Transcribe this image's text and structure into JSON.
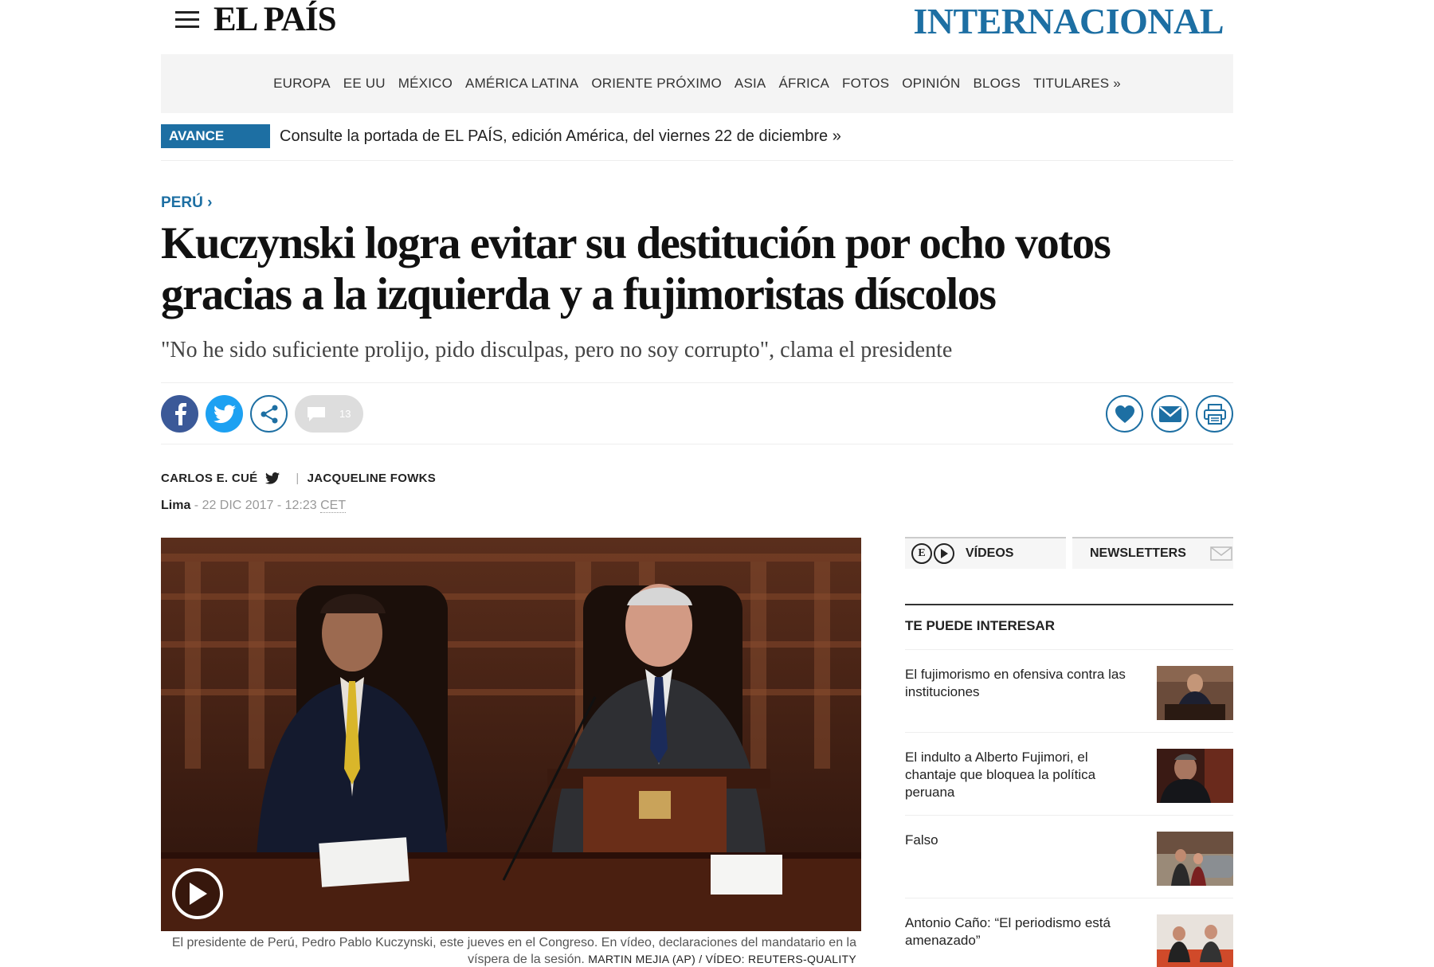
{
  "header": {
    "logo": "EL PAÍS",
    "section": "INTERNACIONAL"
  },
  "nav": {
    "items": [
      "EUROPA",
      "EE UU",
      "MÉXICO",
      "AMÉRICA LATINA",
      "ORIENTE PRÓXIMO",
      "ASIA",
      "ÁFRICA",
      "FOTOS",
      "OPINIÓN",
      "BLOGS",
      "TITULARES »"
    ]
  },
  "avance": {
    "tag": "AVANCE",
    "text": "Consulte la portada de EL PAÍS, edición América, del viernes 22 de diciembre »"
  },
  "article": {
    "kicker": "PERÚ ›",
    "headline": "Kuczynski logra evitar su destitución por ocho votos gracias a la izquierda y a fujimoristas díscolos",
    "subhead": "\"No he sido suficiente prolijo, pido disculpas, pero no soy corrupto\", clama el presidente",
    "comment_count": "13",
    "author1": "CARLOS E. CUÉ",
    "separator": "|",
    "author2": "JACQUELINE FOWKS",
    "location": "Lima",
    "date": " - 22 DIC 2017 - 12:23 ",
    "timezone": "CET",
    "caption": "El presidente de Perú, Pedro Pablo Kuczynski, este jueves en el Congreso. En vídeo, declaraciones del mandatario en la víspera de la sesión.",
    "credit": "MARTIN MEJIA (AP) / VÍDEO: REUTERS-QUALITY"
  },
  "sidebar": {
    "tab_videos": "VÍDEOS",
    "tab_newsletters": "NEWSLETTERS",
    "ep_logo_letter": "E",
    "interest_title": "TE PUEDE INTERESAR",
    "items": [
      {
        "title": "El fujimorismo en ofensiva contra las instituciones"
      },
      {
        "title": "El indulto a Alberto Fujimori, el chantaje que bloquea la política peruana"
      },
      {
        "title": "Falso"
      },
      {
        "title": "Antonio Caño: “El periodismo está amenazado”"
      }
    ]
  },
  "colors": {
    "brand_blue": "#1d6fa3",
    "facebook": "#3b5998",
    "twitter": "#1da1f2"
  }
}
